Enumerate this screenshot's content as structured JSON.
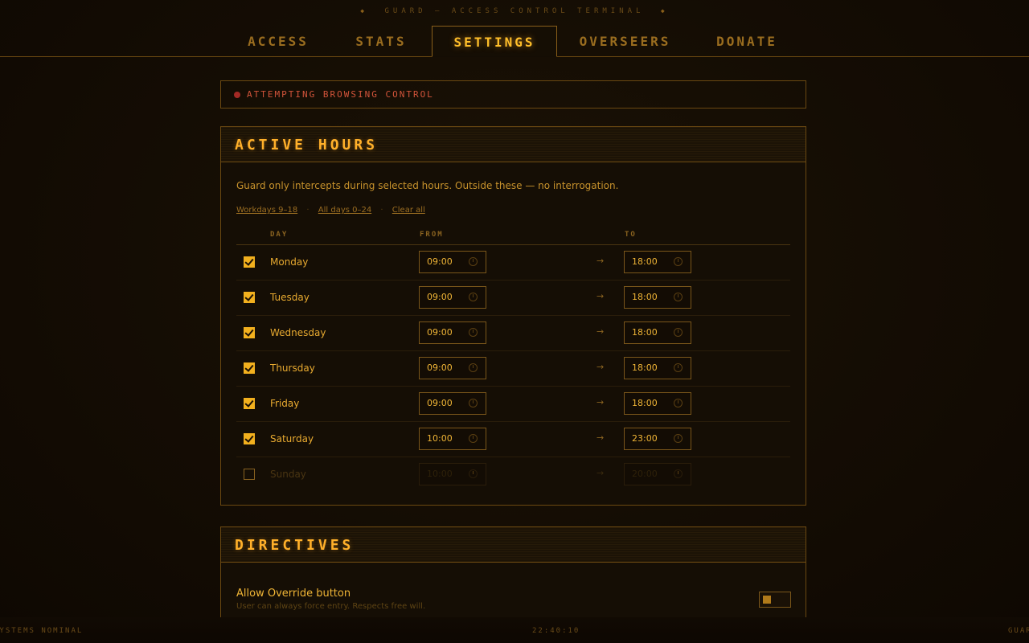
{
  "header": {
    "brand": "GUARD — ACCESS CONTROL TERMINAL",
    "diamond": "◆",
    "tabs": [
      {
        "label": "ACCESS"
      },
      {
        "label": "STATS"
      },
      {
        "label": "SETTINGS",
        "active": true
      },
      {
        "label": "OVERSEERS"
      },
      {
        "label": "DONATE"
      }
    ]
  },
  "alert": {
    "text": "ATTEMPTING BROWSING CONTROL",
    "color": "#a42a25"
  },
  "active_hours": {
    "title": "ACTIVE HOURS",
    "description": "Guard only intercepts during selected hours. Outside these — no interrogation.",
    "presets": [
      "Workdays 9–18",
      "All days 0–24",
      "Clear all"
    ],
    "preset_separator": "·",
    "columns": {
      "day": "DAY",
      "from": "FROM",
      "to": "TO"
    },
    "arrow": "→",
    "rows": [
      {
        "day": "Monday",
        "checked": true,
        "from": "09:00",
        "to": "18:00"
      },
      {
        "day": "Tuesday",
        "checked": true,
        "from": "09:00",
        "to": "18:00"
      },
      {
        "day": "Wednesday",
        "checked": true,
        "from": "09:00",
        "to": "18:00"
      },
      {
        "day": "Thursday",
        "checked": true,
        "from": "09:00",
        "to": "18:00"
      },
      {
        "day": "Friday",
        "checked": true,
        "from": "09:00",
        "to": "18:00"
      },
      {
        "day": "Saturday",
        "checked": true,
        "from": "10:00",
        "to": "23:00"
      },
      {
        "day": "Sunday",
        "checked": false,
        "from": "10:00",
        "to": "20:00"
      }
    ]
  },
  "directives": {
    "title": "DIRECTIVES",
    "items": [
      {
        "label": "Allow Override button",
        "sub": "User can always force entry. Respects free will.",
        "toggle_on": false
      }
    ]
  },
  "status": {
    "left": "SYSTEMS NOMINAL",
    "clock": "22:40:10",
    "right": "GUARD"
  },
  "colors": {
    "accent": "#ffb02a",
    "border": "#6a4811",
    "background": "#140d04",
    "alert_text": "#d2543a"
  }
}
